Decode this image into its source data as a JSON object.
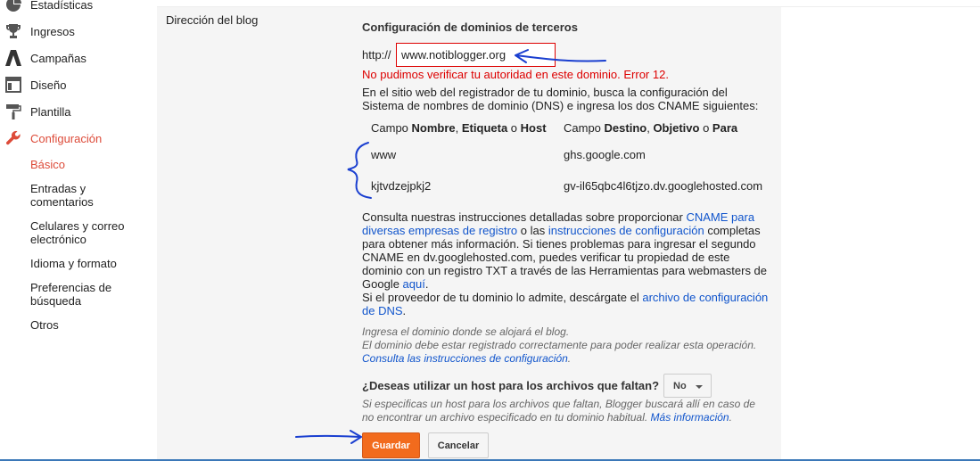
{
  "sidebar": {
    "items": [
      {
        "label": "Estadísticas",
        "icon": "stats-icon"
      },
      {
        "label": "Ingresos",
        "icon": "trophy-icon"
      },
      {
        "label": "Campañas",
        "icon": "adwords-icon"
      },
      {
        "label": "Diseño",
        "icon": "layout-icon"
      },
      {
        "label": "Plantilla",
        "icon": "paint-roller-icon"
      },
      {
        "label": "Configuración",
        "icon": "wrench-icon"
      }
    ],
    "subitems": [
      "Básico",
      "Entradas y comentarios",
      "Celulares y correo electrónico",
      "Idioma y formato",
      "Preferencias de búsqueda",
      "Otros"
    ]
  },
  "row_label": "Dirección del blog",
  "section_title": "Configuración de dominios de terceros",
  "http_prefix": "http://",
  "domain_value": "www.notiblogger.org",
  "error_text": "No pudimos verificar tu autoridad en este dominio. Error 12.",
  "intro": {
    "line1": "En el sitio web del registrador de tu dominio, busca la configuración del",
    "line2": "Sistema de nombres de dominio (DNS) e ingresa los dos CNAME siguientes:"
  },
  "table": {
    "col1_pre": "Campo ",
    "col1_b1": "Nombre",
    "col1_mid": ", ",
    "col1_b2": "Etiqueta",
    "col1_o": " o ",
    "col1_b3": "Host",
    "col2_pre": "Campo ",
    "col2_b1": "Destino",
    "col2_mid": ", ",
    "col2_b2": "Objetivo",
    "col2_o": " o ",
    "col2_b3": "Para",
    "rows": [
      {
        "name": "www",
        "target": "ghs.google.com"
      },
      {
        "name": "kjtvdzejpkj2",
        "target": "gv-il65qbc4l6tjzo.dv.googlehosted.com"
      }
    ]
  },
  "info": {
    "l1_a": "Consulta nuestras instrucciones detalladas sobre proporcionar ",
    "l1_link": "CNAME para",
    "l2_link": "diversas empresas de registro",
    "l2_b": " o las ",
    "l2_link2": "instrucciones de configuración",
    "l2_c": " completas",
    "l3": "para obtener más información. Si tienes problemas para ingresar el segundo",
    "l4": "CNAME en dv.googlehosted.com, puedes verificar tu propiedad de este",
    "l5": "dominio con un registro TXT a través de las Herramientas para webmasters de",
    "l6_a": "Google ",
    "l6_link": "aquí",
    "l6_b": ".",
    "l7_a": "Si el proveedor de tu dominio lo admite, descárgate el ",
    "l7_link": "archivo de configuración",
    "l8_link": "de DNS",
    "l8_b": "."
  },
  "hint1": {
    "l1": "Ingresa el dominio donde se alojará el blog.",
    "l2": "El dominio debe estar registrado correctamente para poder realizar esta operación.",
    "link": "Consulta las instrucciones de configuración",
    "end": "."
  },
  "question": "¿Deseas utilizar un host para los archivos que faltan?",
  "select_value": "No",
  "hint2": {
    "l1": "Si especificas un host para los archivos que faltan, Blogger buscará allí en caso de",
    "l2": "no encontrar un archivo especificado en tu dominio habitual. ",
    "link": "Más información",
    "end": "."
  },
  "buttons": {
    "save": "Guardar",
    "cancel": "Cancelar"
  },
  "colors": {
    "accent": "#dd4b39",
    "error": "#dd0000",
    "link": "#1155cc",
    "save_button": "#f26b1d",
    "annotation": "#1a3fd0"
  }
}
